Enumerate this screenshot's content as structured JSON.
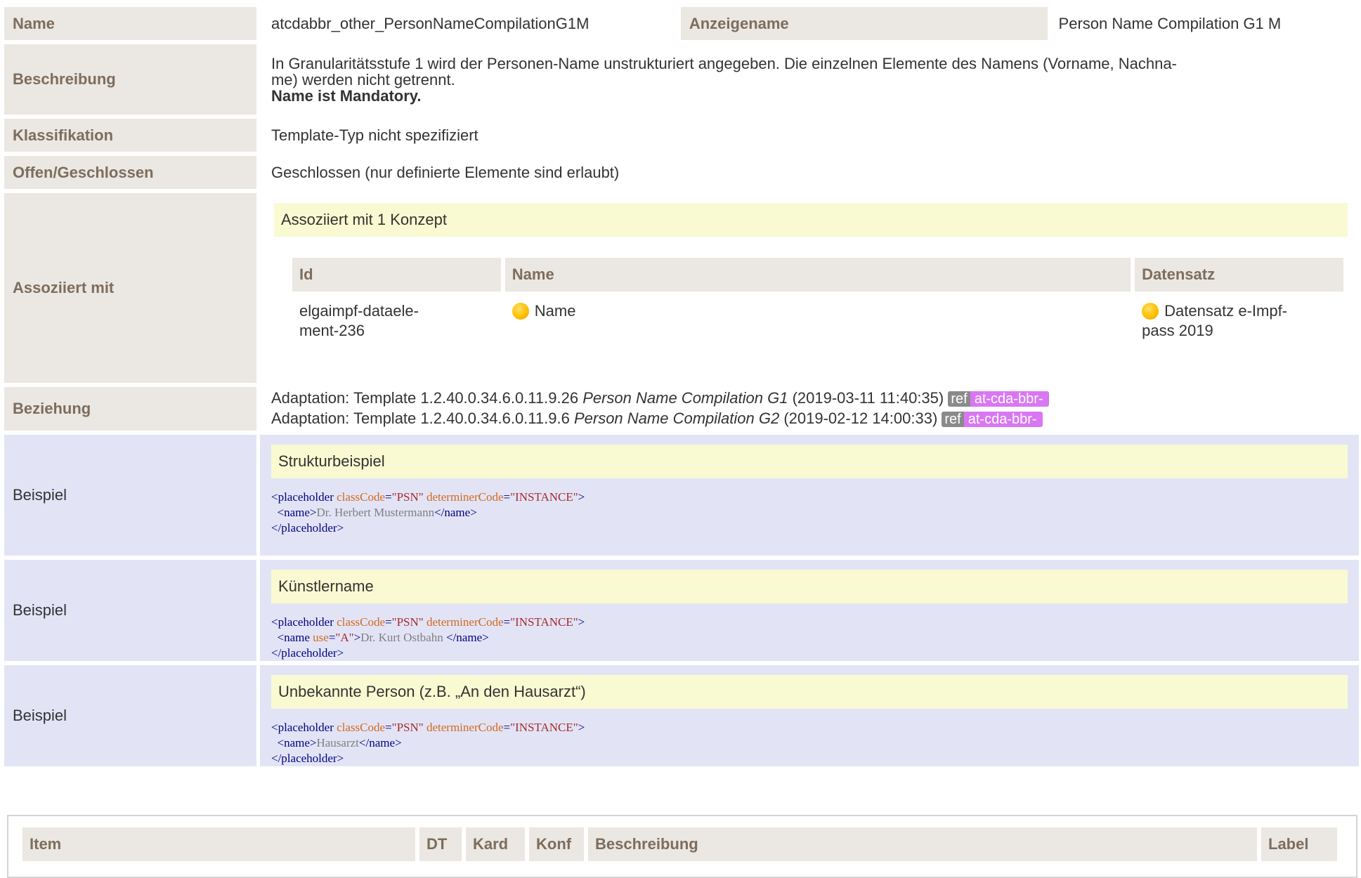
{
  "rows": {
    "name": {
      "label": "Name",
      "value": "atcdabbr_other_PersonNameCompilationG1M",
      "label2": "Anzeigename",
      "value2": "Person Name Compilation G1 M"
    },
    "beschreibung": {
      "label": "Beschreibung",
      "line1": "In Granularitätsstufe 1 wird der Personen-Name unstrukturiert angegeben. Die einzelnen Elemente des Namens (Vorname, Nachna-",
      "line2": "me) werden nicht getrennt.",
      "bold": "Name ist Mandatory."
    },
    "klassifikation": {
      "label": "Klassifikation",
      "value": "Template-Typ nicht spezifiziert"
    },
    "offen": {
      "label": "Offen/Geschlossen",
      "value": "Geschlossen (nur definierte Elemente sind erlaubt)"
    },
    "assoziiert": {
      "label": "Assoziiert mit",
      "header": "Assoziiert mit 1 Konzept",
      "columns": [
        "Id",
        "Name",
        "Datensatz"
      ],
      "row": {
        "id_line1": "elgaimpf-dataele-",
        "id_line2": "ment-236",
        "name": "Name",
        "ds_line1": "Datensatz e-Impf-",
        "ds_line2": "pass 2019"
      }
    },
    "beziehung": {
      "label": "Beziehung",
      "items": [
        {
          "prefix": "Adaptation: Template 1.2.40.0.34.6.0.11.9.26",
          "title": "Person Name Compilation G1",
          "date": "(2019‑03‑11 11:40:35)",
          "ref": "ref",
          "pfx": "at-cda-bbr-"
        },
        {
          "prefix": "Adaptation: Template 1.2.40.0.34.6.0.11.9.6",
          "title": "Person Name Compilation G2",
          "date": "(2019‑02‑12 14:00:33)",
          "ref": "ref",
          "pfx": "at-cda-bbr-"
        }
      ]
    }
  },
  "examples": [
    {
      "label": "Beispiel",
      "title": "Strukturbeispiel",
      "l1": {
        "tag": "<placeholder",
        "a1": "classCode",
        "v1": "\"PSN\"",
        "a2": "determinerCode",
        "v2": "\"INSTANCE\""
      },
      "l2": {
        "open": "<name",
        "attr": "",
        "val": "",
        "close": ">",
        "text": "Dr. Herbert Mustermann",
        "end": "</name>"
      },
      "l3": "</placeholder>"
    },
    {
      "label": "Beispiel",
      "title": "Künstlername",
      "l1": {
        "tag": "<placeholder",
        "a1": "classCode",
        "v1": "\"PSN\"",
        "a2": "determinerCode",
        "v2": "\"INSTANCE\""
      },
      "l2": {
        "open": "<name",
        "attr": "use",
        "val": "\"A\"",
        "close": ">",
        "text": "Dr. Kurt Ostbahn ",
        "end": "</name>"
      },
      "l3": "</placeholder>"
    },
    {
      "label": "Beispiel",
      "title": "Unbekannte Person (z.B. „An den Hausarzt“)",
      "l1": {
        "tag": "<placeholder",
        "a1": "classCode",
        "v1": "\"PSN\"",
        "a2": "determinerCode",
        "v2": "\"INSTANCE\""
      },
      "l2": {
        "open": "<name",
        "attr": "",
        "val": "",
        "close": ">",
        "text": "Hausarzt",
        "end": "</name>"
      },
      "l3": "</placeholder>"
    }
  ],
  "items_table": {
    "columns": [
      "Item",
      "DT",
      "Kard",
      "Konf",
      "Beschreibung",
      "Label"
    ]
  },
  "colors": {
    "label_bg": "#ebe7e3",
    "label_text": "#7d6d5c",
    "example_bg": "#e2e4f6",
    "highlight_bg": "#fafad2",
    "ref_badge": "#8a8a8a",
    "prefix_badge": "#d977f3",
    "concept_dot": "#ffc000"
  }
}
